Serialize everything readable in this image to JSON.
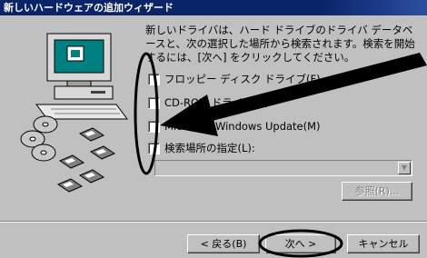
{
  "window": {
    "title": "新しいハードウェアの追加ウィザード"
  },
  "instruction": "新しいドライバは、ハード ドライブのドライバ データベースと、次の選択した場所から検索されます。検索を開始するには、[次へ] をクリックしてください。",
  "options": [
    {
      "label": "フロッピー ディスク ドライブ(F)",
      "checked": false
    },
    {
      "label": "CD-ROM ドライブ(C)",
      "checked": false
    },
    {
      "label": "Microsoft Windows Update(M)",
      "checked": false
    },
    {
      "label": "検索場所の指定(L):",
      "checked": false
    }
  ],
  "location": {
    "value": "",
    "browse_label": "参照(R)..."
  },
  "buttons": {
    "back": "< 戻る(B)",
    "next": "次へ >",
    "cancel": "キャンセル"
  },
  "icons": {
    "computer": "computer-icon",
    "cd": "cd-icon",
    "floppy": "floppy-disk-icon",
    "arrow": "annotation-arrow-icon"
  },
  "colors": {
    "titlebar": "#0a246a",
    "dialog": "#c0c0c0",
    "screen": "#008080",
    "annotation": "#000000"
  }
}
